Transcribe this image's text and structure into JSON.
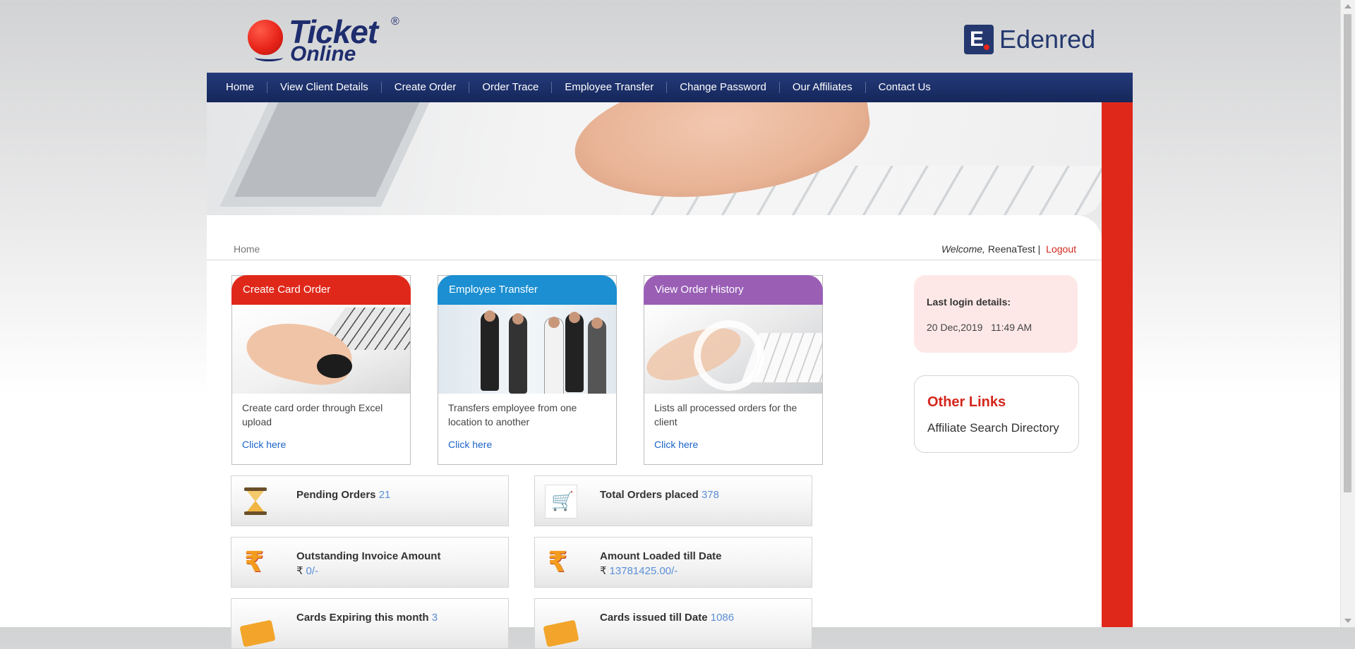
{
  "brand": {
    "ticket_word": "Ticket",
    "ticket_reg": "®",
    "online_word": "Online",
    "edenred_letter": "E",
    "edenred_word": "Edenred"
  },
  "nav": {
    "items": [
      "Home",
      "View Client Details",
      "Create Order",
      "Order Trace",
      "Employee Transfer",
      "Change Password",
      "Our Affiliates",
      "Contact Us"
    ]
  },
  "breadcrumb": "Home",
  "welcome": {
    "prefix": "Welcome,",
    "user": "ReenaTest",
    "separator": "|",
    "logout": "Logout"
  },
  "cards": [
    {
      "title": "Create Card Order",
      "desc": "Create card order through Excel upload",
      "link": "Click here",
      "color": "#e0281a"
    },
    {
      "title": "Employee Transfer",
      "desc": "Transfers employee from one location to another",
      "link": "Click here",
      "color": "#1b8fd1"
    },
    {
      "title": "View Order History",
      "desc": "Lists all processed orders for the client",
      "link": "Click here",
      "color": "#9a5fb5"
    }
  ],
  "last_login": {
    "label": "Last login details:",
    "date": "20 Dec,2019",
    "time": "11:49 AM"
  },
  "other_links": {
    "title": "Other Links",
    "item": "Affiliate Search Directory"
  },
  "stats": {
    "pending": {
      "label": "Pending Orders",
      "value": "21",
      "icon": "hourglass-icon"
    },
    "total": {
      "label": "Total Orders placed",
      "value": "378",
      "icon": "cart-icon"
    },
    "outstanding": {
      "label": "Outstanding Invoice Amount",
      "currency": "₹",
      "value": "0/-",
      "icon": "rupee-icon"
    },
    "loaded": {
      "label": "Amount Loaded till Date",
      "currency": "₹",
      "value": "13781425.00/-",
      "icon": "rupee-icon"
    },
    "expiring": {
      "label": "Cards Expiring this month",
      "value": "3",
      "icon": "card-icon"
    },
    "issued": {
      "label": "Cards issued till Date",
      "value": "1086",
      "icon": "card-icon"
    }
  },
  "icons": {
    "rupee_glyph": "₹",
    "cart_glyph": "🛒"
  },
  "colors": {
    "nav_bg": "#1c2f6b",
    "accent_red": "#e0281a",
    "link_blue": "#1a63c9",
    "stat_value": "#5a8fd6"
  }
}
